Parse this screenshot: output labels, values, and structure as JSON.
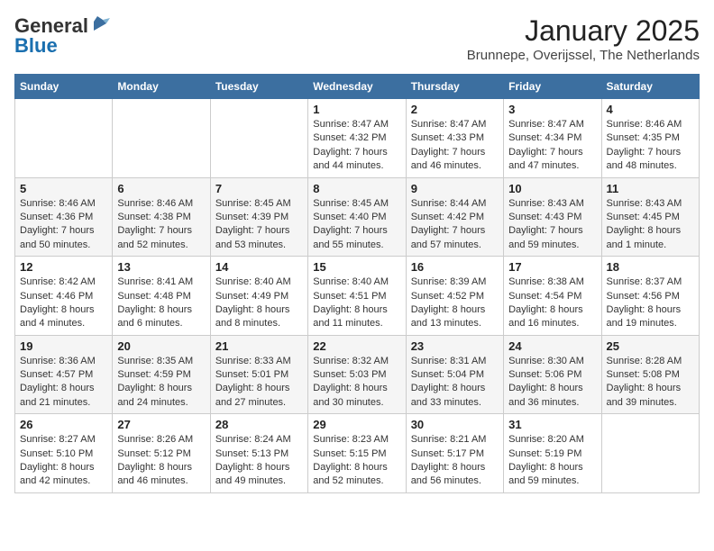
{
  "header": {
    "logo_line1": "General",
    "logo_line2": "Blue",
    "title": "January 2025",
    "subtitle": "Brunnepe, Overijssel, The Netherlands"
  },
  "weekdays": [
    "Sunday",
    "Monday",
    "Tuesday",
    "Wednesday",
    "Thursday",
    "Friday",
    "Saturday"
  ],
  "weeks": [
    [
      {
        "day": "",
        "info": ""
      },
      {
        "day": "",
        "info": ""
      },
      {
        "day": "",
        "info": ""
      },
      {
        "day": "1",
        "info": "Sunrise: 8:47 AM\nSunset: 4:32 PM\nDaylight: 7 hours and 44 minutes."
      },
      {
        "day": "2",
        "info": "Sunrise: 8:47 AM\nSunset: 4:33 PM\nDaylight: 7 hours and 46 minutes."
      },
      {
        "day": "3",
        "info": "Sunrise: 8:47 AM\nSunset: 4:34 PM\nDaylight: 7 hours and 47 minutes."
      },
      {
        "day": "4",
        "info": "Sunrise: 8:46 AM\nSunset: 4:35 PM\nDaylight: 7 hours and 48 minutes."
      }
    ],
    [
      {
        "day": "5",
        "info": "Sunrise: 8:46 AM\nSunset: 4:36 PM\nDaylight: 7 hours and 50 minutes."
      },
      {
        "day": "6",
        "info": "Sunrise: 8:46 AM\nSunset: 4:38 PM\nDaylight: 7 hours and 52 minutes."
      },
      {
        "day": "7",
        "info": "Sunrise: 8:45 AM\nSunset: 4:39 PM\nDaylight: 7 hours and 53 minutes."
      },
      {
        "day": "8",
        "info": "Sunrise: 8:45 AM\nSunset: 4:40 PM\nDaylight: 7 hours and 55 minutes."
      },
      {
        "day": "9",
        "info": "Sunrise: 8:44 AM\nSunset: 4:42 PM\nDaylight: 7 hours and 57 minutes."
      },
      {
        "day": "10",
        "info": "Sunrise: 8:43 AM\nSunset: 4:43 PM\nDaylight: 7 hours and 59 minutes."
      },
      {
        "day": "11",
        "info": "Sunrise: 8:43 AM\nSunset: 4:45 PM\nDaylight: 8 hours and 1 minute."
      }
    ],
    [
      {
        "day": "12",
        "info": "Sunrise: 8:42 AM\nSunset: 4:46 PM\nDaylight: 8 hours and 4 minutes."
      },
      {
        "day": "13",
        "info": "Sunrise: 8:41 AM\nSunset: 4:48 PM\nDaylight: 8 hours and 6 minutes."
      },
      {
        "day": "14",
        "info": "Sunrise: 8:40 AM\nSunset: 4:49 PM\nDaylight: 8 hours and 8 minutes."
      },
      {
        "day": "15",
        "info": "Sunrise: 8:40 AM\nSunset: 4:51 PM\nDaylight: 8 hours and 11 minutes."
      },
      {
        "day": "16",
        "info": "Sunrise: 8:39 AM\nSunset: 4:52 PM\nDaylight: 8 hours and 13 minutes."
      },
      {
        "day": "17",
        "info": "Sunrise: 8:38 AM\nSunset: 4:54 PM\nDaylight: 8 hours and 16 minutes."
      },
      {
        "day": "18",
        "info": "Sunrise: 8:37 AM\nSunset: 4:56 PM\nDaylight: 8 hours and 19 minutes."
      }
    ],
    [
      {
        "day": "19",
        "info": "Sunrise: 8:36 AM\nSunset: 4:57 PM\nDaylight: 8 hours and 21 minutes."
      },
      {
        "day": "20",
        "info": "Sunrise: 8:35 AM\nSunset: 4:59 PM\nDaylight: 8 hours and 24 minutes."
      },
      {
        "day": "21",
        "info": "Sunrise: 8:33 AM\nSunset: 5:01 PM\nDaylight: 8 hours and 27 minutes."
      },
      {
        "day": "22",
        "info": "Sunrise: 8:32 AM\nSunset: 5:03 PM\nDaylight: 8 hours and 30 minutes."
      },
      {
        "day": "23",
        "info": "Sunrise: 8:31 AM\nSunset: 5:04 PM\nDaylight: 8 hours and 33 minutes."
      },
      {
        "day": "24",
        "info": "Sunrise: 8:30 AM\nSunset: 5:06 PM\nDaylight: 8 hours and 36 minutes."
      },
      {
        "day": "25",
        "info": "Sunrise: 8:28 AM\nSunset: 5:08 PM\nDaylight: 8 hours and 39 minutes."
      }
    ],
    [
      {
        "day": "26",
        "info": "Sunrise: 8:27 AM\nSunset: 5:10 PM\nDaylight: 8 hours and 42 minutes."
      },
      {
        "day": "27",
        "info": "Sunrise: 8:26 AM\nSunset: 5:12 PM\nDaylight: 8 hours and 46 minutes."
      },
      {
        "day": "28",
        "info": "Sunrise: 8:24 AM\nSunset: 5:13 PM\nDaylight: 8 hours and 49 minutes."
      },
      {
        "day": "29",
        "info": "Sunrise: 8:23 AM\nSunset: 5:15 PM\nDaylight: 8 hours and 52 minutes."
      },
      {
        "day": "30",
        "info": "Sunrise: 8:21 AM\nSunset: 5:17 PM\nDaylight: 8 hours and 56 minutes."
      },
      {
        "day": "31",
        "info": "Sunrise: 8:20 AM\nSunset: 5:19 PM\nDaylight: 8 hours and 59 minutes."
      },
      {
        "day": "",
        "info": ""
      }
    ]
  ]
}
